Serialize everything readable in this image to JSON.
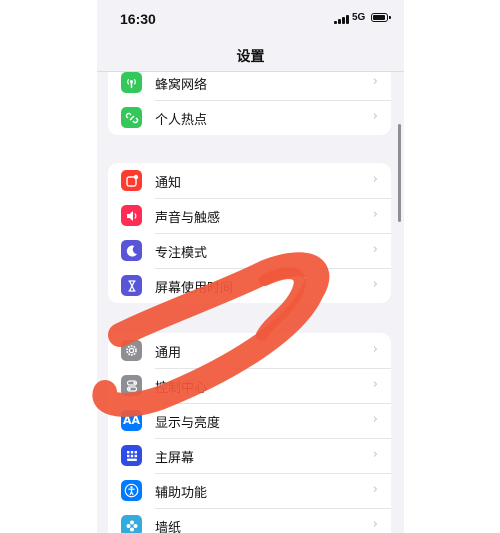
{
  "status_bar": {
    "time": "16:30",
    "network": "5G"
  },
  "navbar": {
    "title": "设置"
  },
  "groups": [
    {
      "items": [
        {
          "label": "蜂窝网络",
          "icon": "cellular-icon",
          "color": "#34c759"
        },
        {
          "label": "个人热点",
          "icon": "hotspot-icon",
          "color": "#34c759"
        }
      ]
    },
    {
      "items": [
        {
          "label": "通知",
          "icon": "notification-icon",
          "color": "#ff3b30"
        },
        {
          "label": "声音与触感",
          "icon": "sound-icon",
          "color": "#ff2d55"
        },
        {
          "label": "专注模式",
          "icon": "focus-moon-icon",
          "color": "#5856d6"
        },
        {
          "label": "屏幕使用时间",
          "icon": "hourglass-icon",
          "color": "#5856d6"
        }
      ]
    },
    {
      "items": [
        {
          "label": "通用",
          "icon": "gear-icon",
          "color": "#8e8e93"
        },
        {
          "label": "控制中心",
          "icon": "control-center-icon",
          "color": "#8e8e93"
        },
        {
          "label": "显示与亮度",
          "icon": "display-aa-icon",
          "color": "#007aff",
          "icon_text": "AA"
        },
        {
          "label": "主屏幕",
          "icon": "home-screen-icon",
          "color": "#2f4de6"
        },
        {
          "label": "辅助功能",
          "icon": "accessibility-icon",
          "color": "#007aff"
        },
        {
          "label": "墙纸",
          "icon": "wallpaper-icon",
          "color": "#35aadc"
        }
      ]
    }
  ],
  "chevron": "›",
  "annotation_color": "#f0583a"
}
